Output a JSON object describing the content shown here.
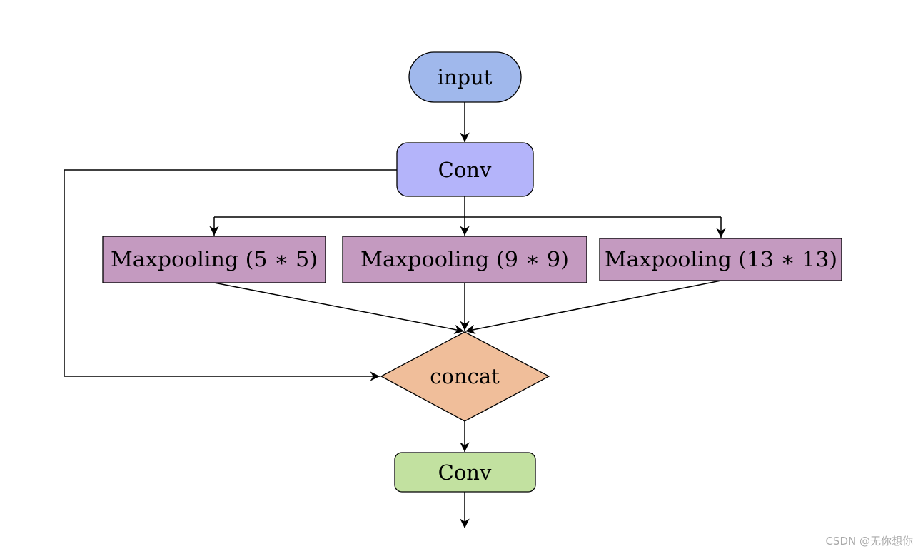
{
  "nodes": {
    "input": {
      "label": "input",
      "color": "#a0b8ec"
    },
    "conv1": {
      "label": "Conv",
      "color": "#b4b4fa"
    },
    "maxpool1": {
      "label": "Maxpooling (5 ∗ 5)",
      "color": "#c49ac0"
    },
    "maxpool2": {
      "label": "Maxpooling (9 ∗ 9)",
      "color": "#c49ac0"
    },
    "maxpool3": {
      "label": "Maxpooling (13 ∗ 13)",
      "color": "#c49ac0"
    },
    "concat": {
      "label": "concat",
      "color": "#f0be9a"
    },
    "conv2": {
      "label": "Conv",
      "color": "#c2e1a0"
    }
  },
  "watermark": "CSDN @无你想你"
}
